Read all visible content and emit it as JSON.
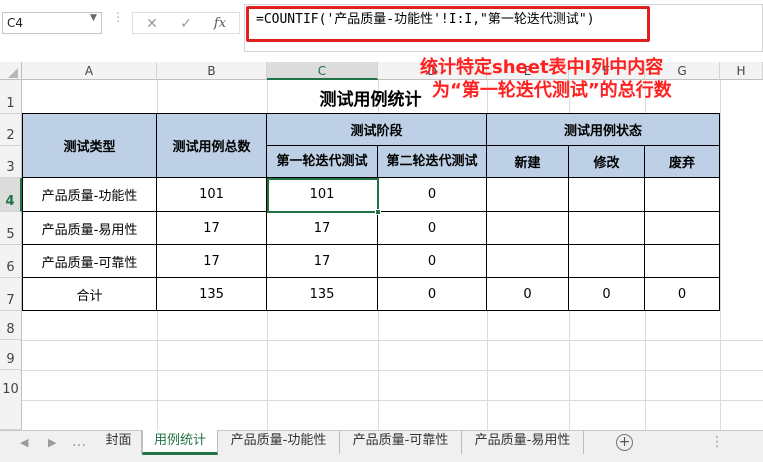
{
  "name_box": {
    "value": "C4"
  },
  "formula_bar": {
    "cancel_icon": "✕",
    "enter_icon": "✓",
    "fx_label": "fx",
    "formula": "=COUNTIF('产品质量-功能性'!I:I,\"第一轮迭代测试\")"
  },
  "annotation": {
    "line1": "统计特定sheet表中I列中内容",
    "line2": "为“第一轮迭代测试”的总行数",
    "color": "#ff2020"
  },
  "columns": [
    "A",
    "B",
    "C",
    "D",
    "E",
    "F",
    "G",
    "H"
  ],
  "selected_column": "C",
  "rows": [
    "1",
    "2",
    "3",
    "4",
    "5",
    "6",
    "7",
    "8",
    "9",
    "10"
  ],
  "selected_row": "4",
  "table": {
    "title": "测试用例统计",
    "header_type": "测试类型",
    "header_total": "测试用例总数",
    "header_phase": "测试阶段",
    "header_phase_round1": "第一轮迭代测试",
    "header_phase_round2": "第二轮迭代测试",
    "header_status": "测试用例状态",
    "header_status_new": "新建",
    "header_status_modified": "修改",
    "header_status_discarded": "废弃",
    "header_fill_color": "#bdd0e6",
    "data_rows": [
      {
        "type": "产品质量-功能性",
        "total": "101",
        "round1": "101",
        "round2": "0",
        "new": "",
        "modified": "",
        "discarded": ""
      },
      {
        "type": "产品质量-易用性",
        "total": "17",
        "round1": "17",
        "round2": "0",
        "new": "",
        "modified": "",
        "discarded": ""
      },
      {
        "type": "产品质量-可靠性",
        "total": "17",
        "round1": "17",
        "round2": "0",
        "new": "",
        "modified": "",
        "discarded": ""
      },
      {
        "type": "合计",
        "total": "135",
        "round1": "135",
        "round2": "0",
        "new": "0",
        "modified": "0",
        "discarded": "0"
      }
    ]
  },
  "sheet_tabs": [
    {
      "label": "封面",
      "active": false
    },
    {
      "label": "用例统计",
      "active": true
    },
    {
      "label": "产品质量-功能性",
      "active": false
    },
    {
      "label": "产品质量-可靠性",
      "active": false
    },
    {
      "label": "产品质量-易用性",
      "active": false
    }
  ],
  "accent_color": "#217346",
  "icons": {
    "prev_sheet": "◀",
    "next_sheet": "▶",
    "add_sheet": "+",
    "tab_more": "…"
  }
}
